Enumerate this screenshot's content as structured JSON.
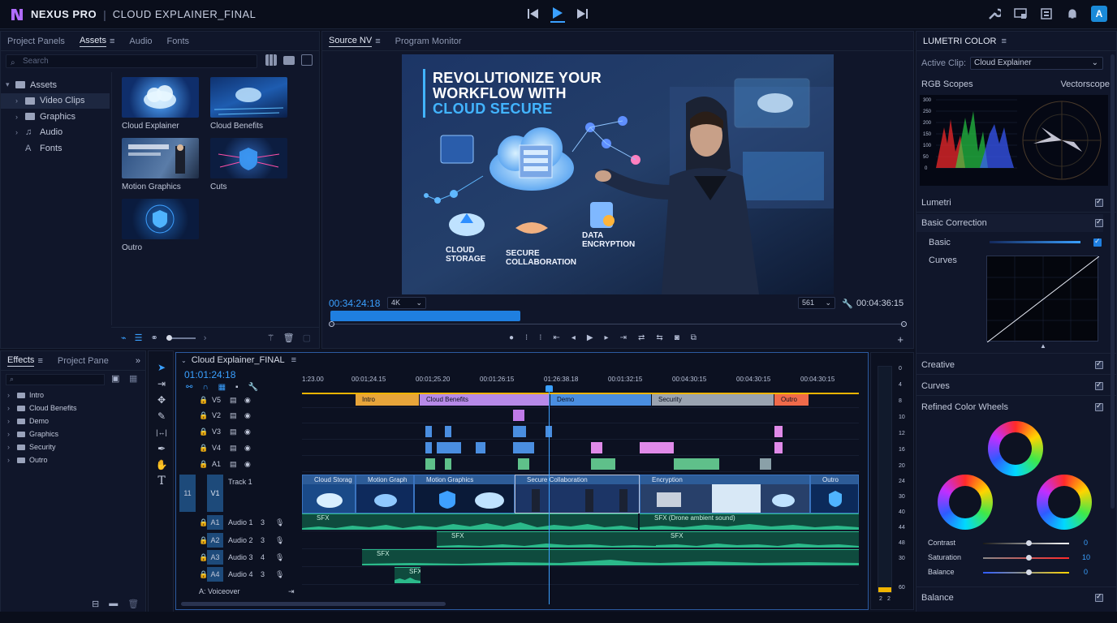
{
  "app": {
    "brand": "NEXUS PRO",
    "separator": "|",
    "project": "CLOUD EXPLAINER_FINAL",
    "avatar": "A"
  },
  "colors": {
    "accent": "#3aa0ff",
    "panel": "#10162a",
    "bg": "#0d1222"
  },
  "project_panel": {
    "tabs": [
      "Project Panels",
      "Assets",
      "Audio",
      "Fonts"
    ],
    "active_tab": "Assets",
    "search_placeholder": "Search",
    "tree": [
      {
        "label": "Assets"
      },
      {
        "label": "Video Clips"
      },
      {
        "label": "Graphics"
      },
      {
        "label": "Audio"
      },
      {
        "label": "Fonts"
      }
    ],
    "thumbs": [
      "Cloud Explainer",
      "Cloud Benefits",
      "Motion Graphics",
      "Cuts",
      "Outro"
    ]
  },
  "monitor": {
    "tabs": [
      "Source NV",
      "Program Monitor"
    ],
    "active_tab": "Source NV",
    "headline_1": "REVOLUTIONIZE YOUR",
    "headline_2": "WORKFLOW WITH",
    "headline_3": "CLOUD SECURE",
    "cap_storage_1": "CLOUD",
    "cap_storage_2": "STORAGE",
    "cap_collab_1": "SECURE",
    "cap_collab_2": "COLLABORATION",
    "cap_enc_1": "DATA",
    "cap_enc_2": "ENCRYPTION",
    "timecode_in": "00:34:24:18",
    "resolution": "4K",
    "zoom": "561",
    "timecode_dur": "00:04:36:15",
    "progress_fraction": 0.33
  },
  "lumetri": {
    "title": "LUMETRI COLOR",
    "active_clip_label": "Active Clip:",
    "active_clip": "Cloud Explainer",
    "rgb_scopes": "RGB Scopes",
    "vectorscope": "Vectorscope",
    "scope_ticks": [
      "300",
      "250",
      "200",
      "150",
      "100",
      "50",
      "0"
    ],
    "sections": [
      "Lumetri",
      "Basic Correction",
      "Basic",
      "Curves",
      "Creative",
      "Curves",
      "Refined Color Wheels",
      "Balance"
    ],
    "sliders": [
      {
        "label": "Contrast",
        "value": "0"
      },
      {
        "label": "Saturation",
        "value": "10"
      },
      {
        "label": "Balance",
        "value": "0"
      }
    ]
  },
  "effects": {
    "tabs": [
      "Effects",
      "Project Pane"
    ],
    "active_tab": "Effects",
    "items": [
      "Intro",
      "Cloud Benefits",
      "Demo",
      "Graphics",
      "Security",
      "Outro"
    ]
  },
  "timeline": {
    "title": "Cloud Explainer_FINAL",
    "timecode": "01:01:24:18",
    "ruler": [
      "1:23.00",
      "00:01;24.15",
      "00:01;25.20",
      "00:01:26:15",
      "01:26:38.18",
      "00:01:32:15",
      "00:04:30:15",
      "00:04:30:15",
      "00:04:30:15"
    ],
    "tracks": [
      {
        "id": "V5",
        "name": ""
      },
      {
        "id": "V2",
        "name": ""
      },
      {
        "id": "V3",
        "name": ""
      },
      {
        "id": "V4",
        "name": ""
      },
      {
        "id": "A1",
        "name": ""
      },
      {
        "id": "V1",
        "name": "Track 1"
      },
      {
        "id": "A1",
        "name": "Audio 1",
        "n": "3"
      },
      {
        "id": "A2",
        "name": "Audio 2",
        "n": "3"
      },
      {
        "id": "A3",
        "name": "Audio 3",
        "n": "4"
      },
      {
        "id": "A4",
        "name": "Audio 4",
        "n": "3"
      }
    ],
    "track_v1_num": "11",
    "voiceover": "A:  Voiceover",
    "top_clips": [
      "Intro",
      "Cloud Benefits",
      "Demo",
      "Security",
      "Outro"
    ],
    "v1_clips": [
      "Cloud Storag",
      "Motion Graph",
      "Motion Graphics",
      "Secure Collaboration",
      "Encryption",
      "Outro"
    ],
    "audio_clips": [
      "SFX",
      "SFX (Drone ambient sound)",
      "SFX",
      "SFX",
      "SFX",
      "SFX"
    ]
  },
  "meter": {
    "ticks": [
      "0",
      "4",
      "8",
      "10",
      "12",
      "16",
      "20",
      "24",
      "30",
      "40",
      "44",
      "48",
      "30",
      "60"
    ],
    "channels": [
      "2",
      "2"
    ]
  }
}
